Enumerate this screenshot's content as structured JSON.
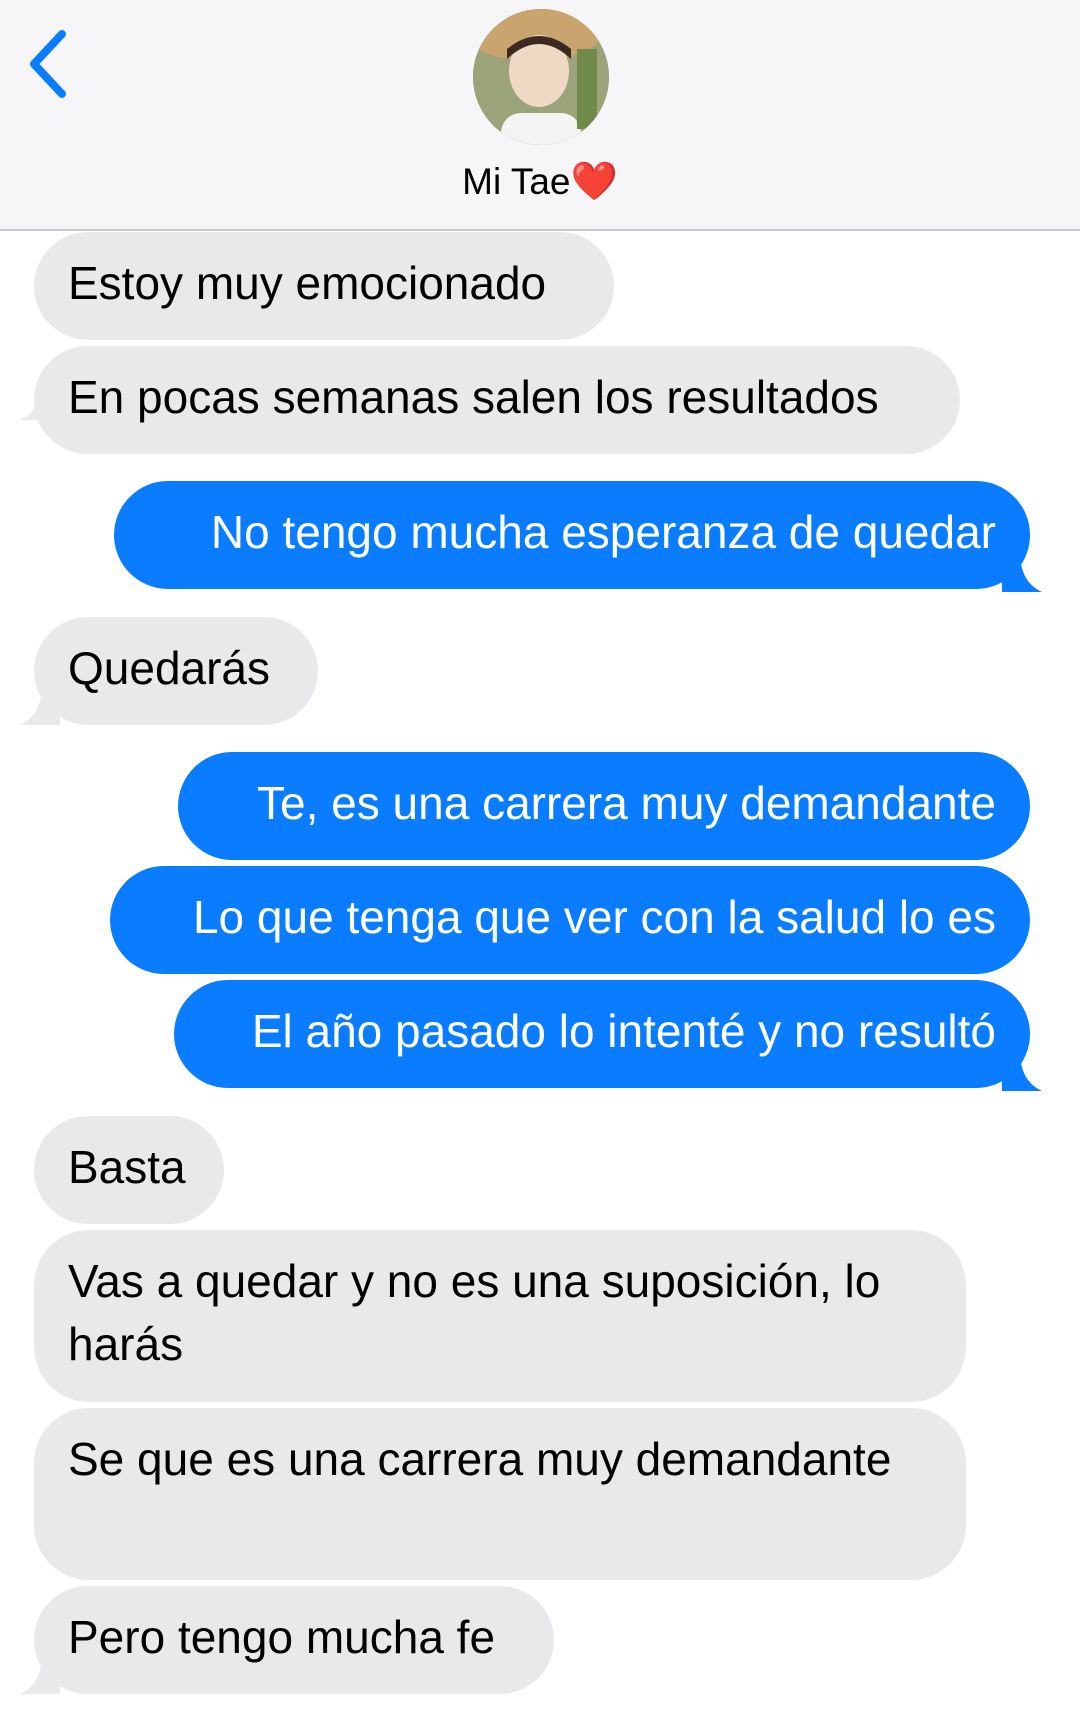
{
  "header": {
    "back_icon": "chevron-left-icon",
    "contact_name": "Mi Tae",
    "name_emoji": "❤️",
    "accent_color": "#0a7cff"
  },
  "messages": [
    {
      "dir": "in",
      "text": "Estoy muy emocionado"
    },
    {
      "dir": "in",
      "text": "En pocas semanas salen los resultados"
    },
    {
      "dir": "out",
      "text": "No tengo mucha esperanza de quedar"
    },
    {
      "dir": "in",
      "text": "Quedarás"
    },
    {
      "dir": "out",
      "text": "Te, es una carrera muy demandante"
    },
    {
      "dir": "out",
      "text": "Lo que tenga que ver con la salud lo es"
    },
    {
      "dir": "out",
      "text": "El año pasado lo intenté y no resultó"
    },
    {
      "dir": "in",
      "text": "Basta"
    },
    {
      "dir": "in",
      "text": "Vas a quedar y no es una suposición, lo harás"
    },
    {
      "dir": "in",
      "text": "Se que es una carrera muy demandante"
    },
    {
      "dir": "in",
      "text": "Pero tengo mucha fe"
    }
  ],
  "colors": {
    "incoming_bubble": "#e9e9eb",
    "outgoing_bubble": "#0a7cff",
    "header_bg": "#f6f6f8"
  }
}
